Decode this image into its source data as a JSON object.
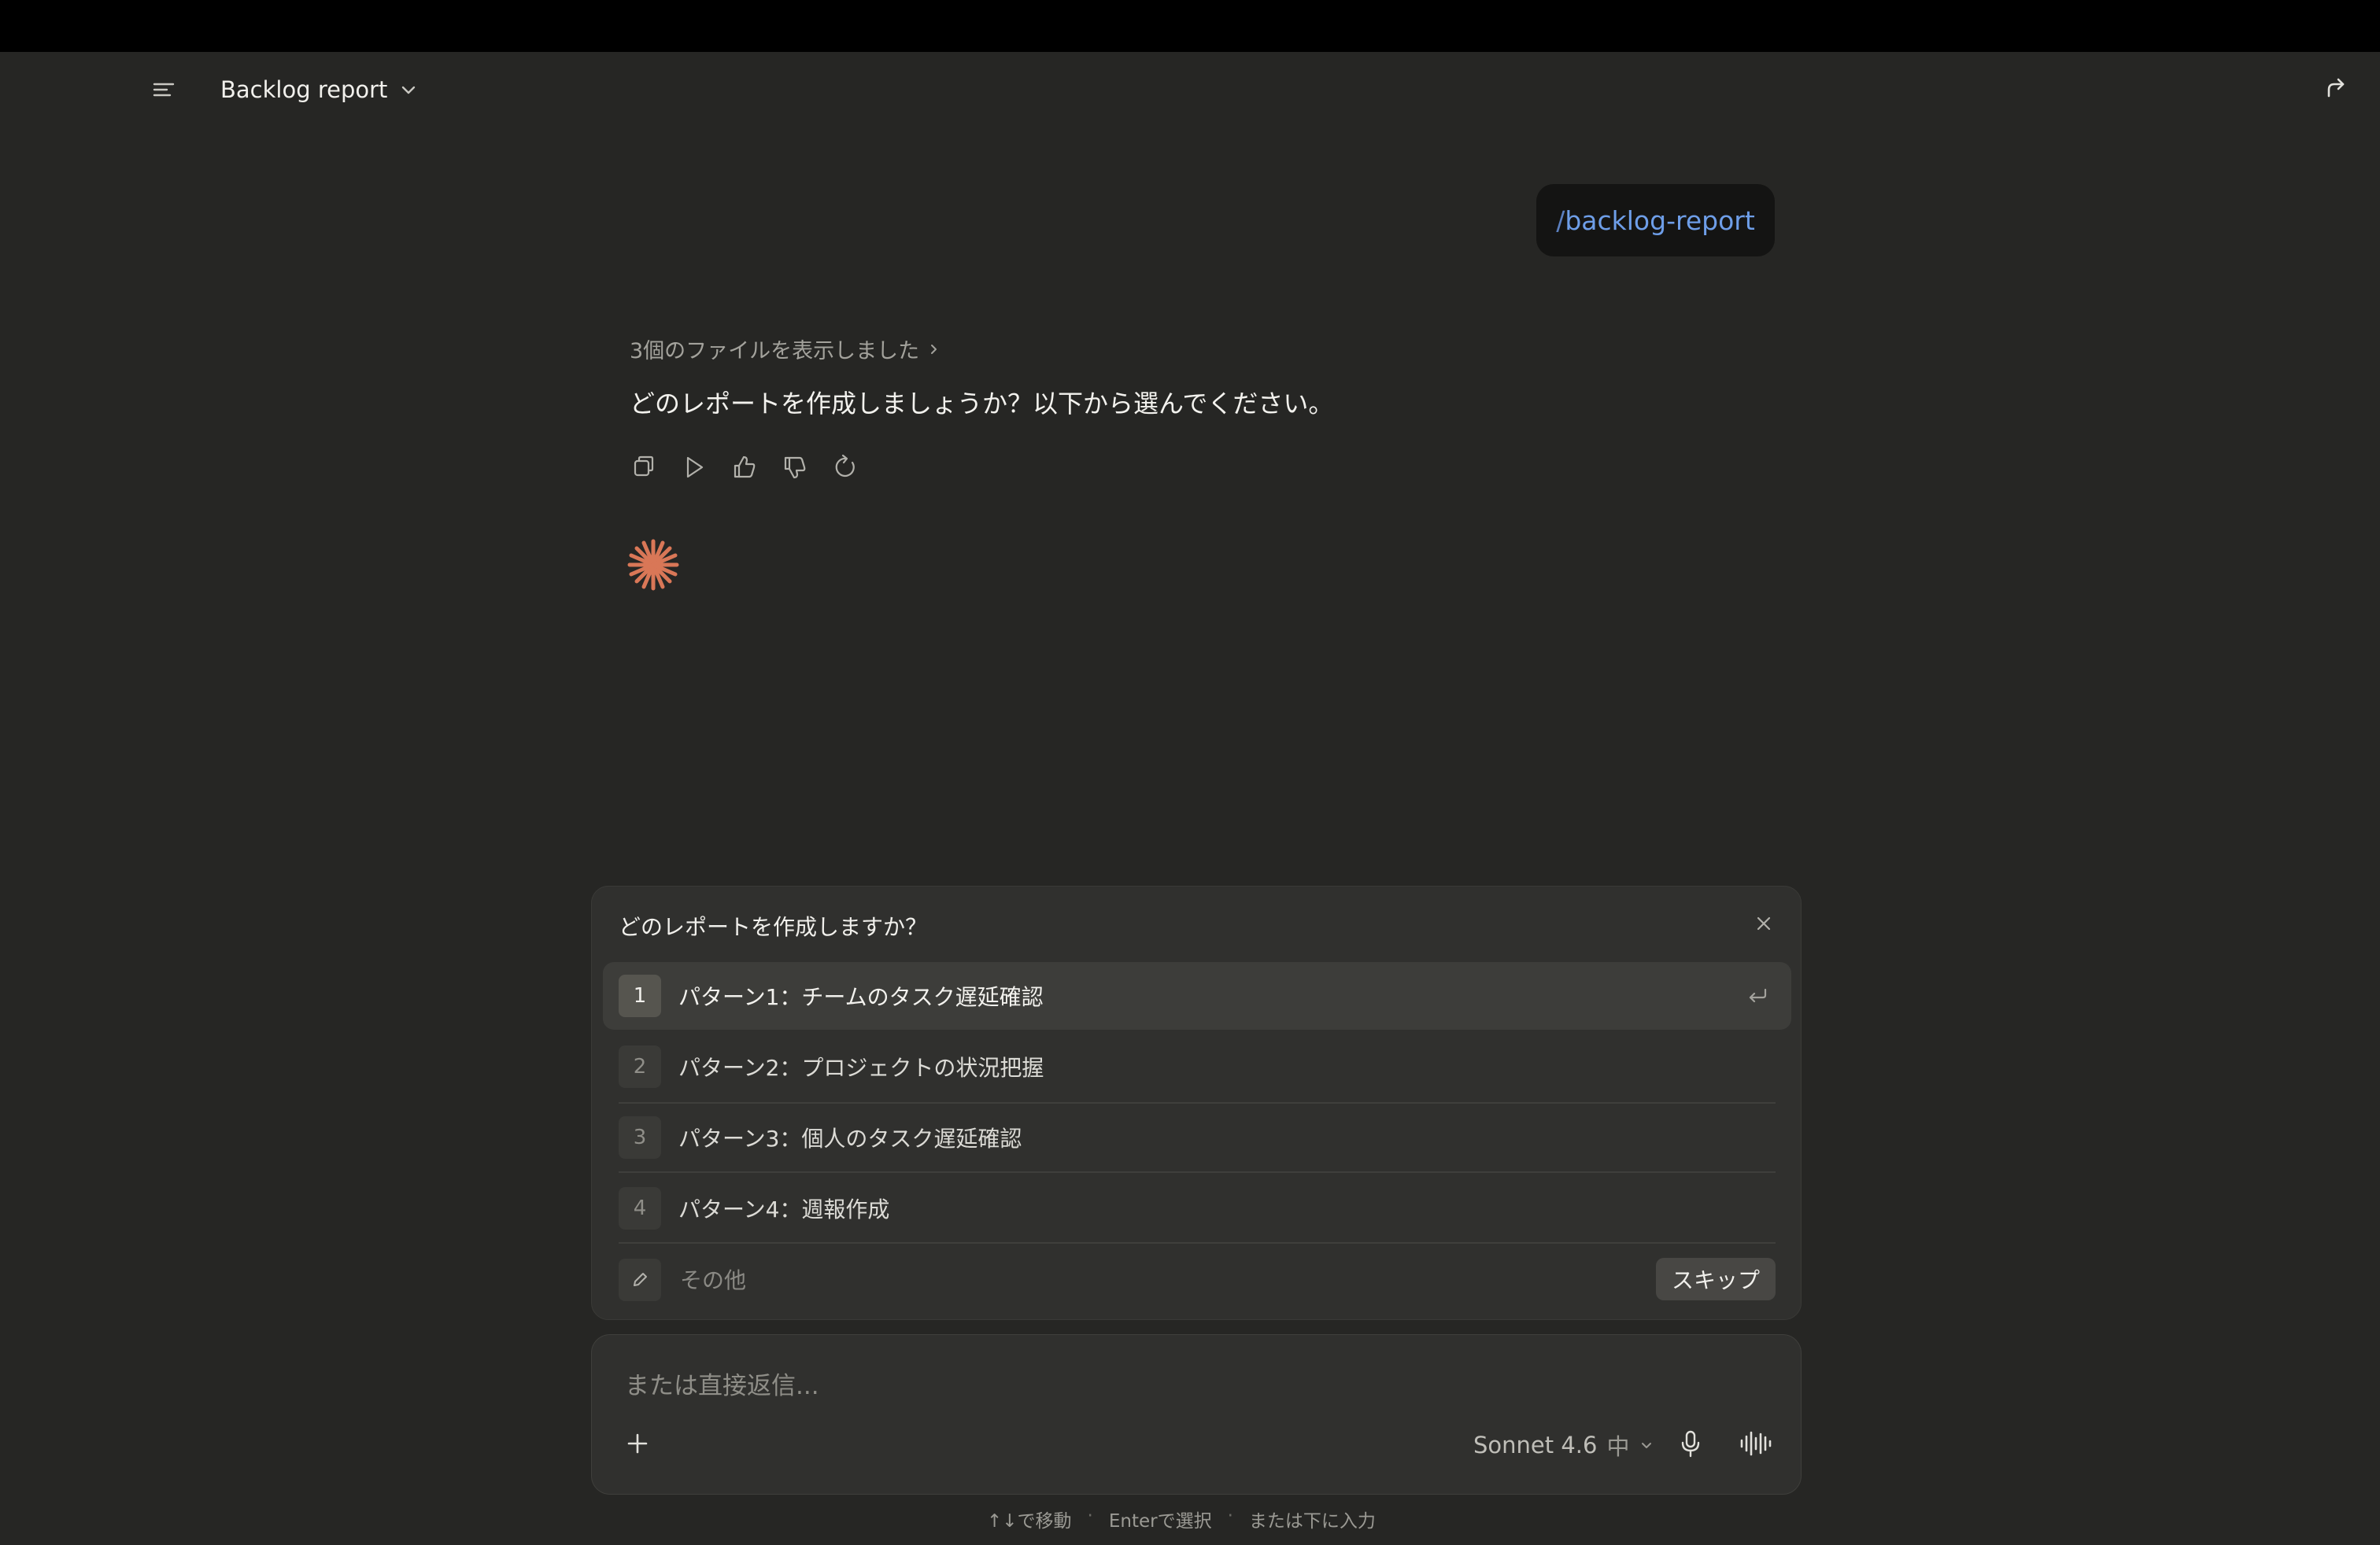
{
  "header": {
    "title": "Backlog report",
    "icons": {
      "sidebar": "sidebar-toggle-icon",
      "title_menu": "chevron-down-icon",
      "share": "share-icon"
    }
  },
  "user_message": {
    "slash": "/",
    "command": "backlog-report"
  },
  "assistant": {
    "files_note": "3個のファイルを表示しました",
    "message": "どのレポートを作成しましょうか？以下から選んでください。",
    "action_icons": [
      "copy-icon",
      "play-icon",
      "thumbs-up-icon",
      "thumbs-down-icon",
      "retry-icon"
    ],
    "spark_color": "#d97757"
  },
  "question": {
    "title": "どのレポートを作成しますか？",
    "options": [
      {
        "num": "1",
        "label": "パターン1：チームのタスク遅延確認"
      },
      {
        "num": "2",
        "label": "パターン2：プロジェクトの状況把握"
      },
      {
        "num": "3",
        "label": "パターン3：個人のタスク遅延確認"
      },
      {
        "num": "4",
        "label": "パターン4：週報作成"
      }
    ],
    "selected_index": 0,
    "other_placeholder": "その他",
    "skip_label": "スキップ"
  },
  "composer": {
    "placeholder": "または直接返信...",
    "model": "Sonnet 4.6",
    "effort": "中"
  },
  "hints": {
    "move": "↑↓で移動",
    "separator": "·",
    "select": "Enterで選択",
    "input": "または下に入力"
  },
  "colors": {
    "background": "#262624",
    "panel": "#30302e",
    "command_link": "#6e9ee8",
    "accent_spark": "#d97757"
  }
}
